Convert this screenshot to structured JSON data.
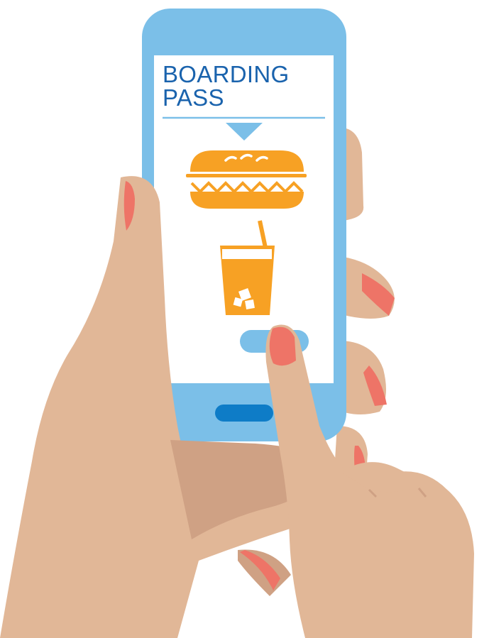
{
  "screen": {
    "title_line1": "BOARDING",
    "title_line2": "PASS"
  },
  "icons": {
    "sandwich": "sandwich-icon",
    "drink": "drink-icon",
    "arrow": "down-arrow-icon"
  },
  "colors": {
    "phone_frame": "#7bbfe8",
    "screen_bg": "#ffffff",
    "title_text": "#1a63ad",
    "divider": "#7bbfe8",
    "food_orange": "#f7a124",
    "button": "#7bbfe8",
    "home_button": "#0e7cc7",
    "skin": "#e1b797",
    "skin_shadow": "#cfa184",
    "nail": "#ee7467"
  }
}
